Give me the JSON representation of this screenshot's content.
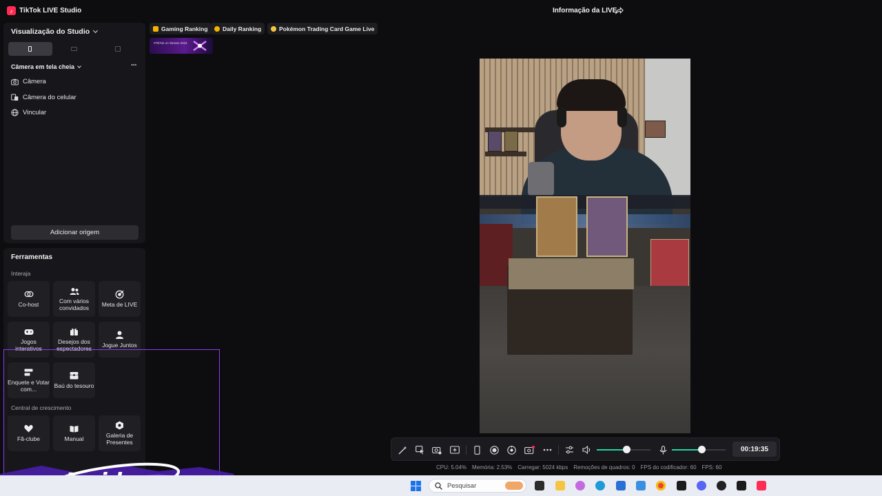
{
  "app": {
    "title": "TikTok LIVE Studio",
    "logo_glyph": "♪",
    "live_info": "Informação da LIVE"
  },
  "studio": {
    "view_label": "Visualização do Studio",
    "orientations": [
      {
        "name": "portrait",
        "active": true
      },
      {
        "name": "landscape",
        "active": false
      },
      {
        "name": "dual",
        "active": false
      }
    ],
    "scene_label": "Câmera em tela cheia",
    "more_label": "···",
    "sources": [
      {
        "label": "Câmera",
        "icon": "camera-icon"
      },
      {
        "label": "Câmera do celular",
        "icon": "phone-camera-icon"
      },
      {
        "label": "Vincular",
        "icon": "globe-icon"
      }
    ],
    "add_source": "Adicionar origem"
  },
  "tools": {
    "title": "Ferramentas",
    "group_interact": "Interaja",
    "interact": [
      {
        "label": "Co-host",
        "icon": "link-icon"
      },
      {
        "label": "Com vários convidados",
        "icon": "users-icon"
      },
      {
        "label": "Meta de LIVE",
        "icon": "target-icon"
      },
      {
        "label": "Jogos interativos",
        "icon": "gamepad-icon"
      },
      {
        "label": "Desejos dos espectadores",
        "icon": "gift-icon"
      },
      {
        "label": "Jogue Juntos",
        "icon": "player-icon"
      },
      {
        "label": "Enquete e Votar com...",
        "icon": "poll-icon"
      },
      {
        "label": "Baú do tesouro",
        "icon": "chest-icon"
      }
    ],
    "group_growth": "Central de crescimento",
    "growth": [
      {
        "label": "Fã-clube",
        "icon": "heart-icon"
      },
      {
        "label": "Manual",
        "icon": "book-icon"
      },
      {
        "label": "Galeria de Presentes",
        "icon": "gallery-icon"
      }
    ]
  },
  "pinned": {
    "chips": [
      {
        "label": "Gaming Ranking",
        "color": "#f5b400"
      },
      {
        "label": "Daily Ranking",
        "color": "#f5b400"
      },
      {
        "label": "Pokémon Trading Card Game Live",
        "color": "#f5c542"
      }
    ],
    "thumb_text": "#TikTok on Stream 2024"
  },
  "controls": {
    "buttons": [
      "magic-wand-icon",
      "layout-icon",
      "screenshot-icon",
      "add-scene-icon",
      "phone-icon",
      "record-icon",
      "effects-icon",
      "multicam-icon",
      "more-icon",
      "mixer-icon"
    ],
    "speaker_level": 0.55,
    "mic_level": 0.55,
    "timer": "00:19:35",
    "accent": "#1ed6a5"
  },
  "status": {
    "items": [
      "CPU: 5.04%",
      "Memória: 2.53%",
      "Carregar: 5024 kbps",
      "Remoções de quadros: 0",
      "FPS do codificador: 60",
      "FPS: 60"
    ]
  },
  "watermark": {
    "text": "Insider"
  },
  "taskbar": {
    "search_placeholder": "Pesquisar"
  }
}
